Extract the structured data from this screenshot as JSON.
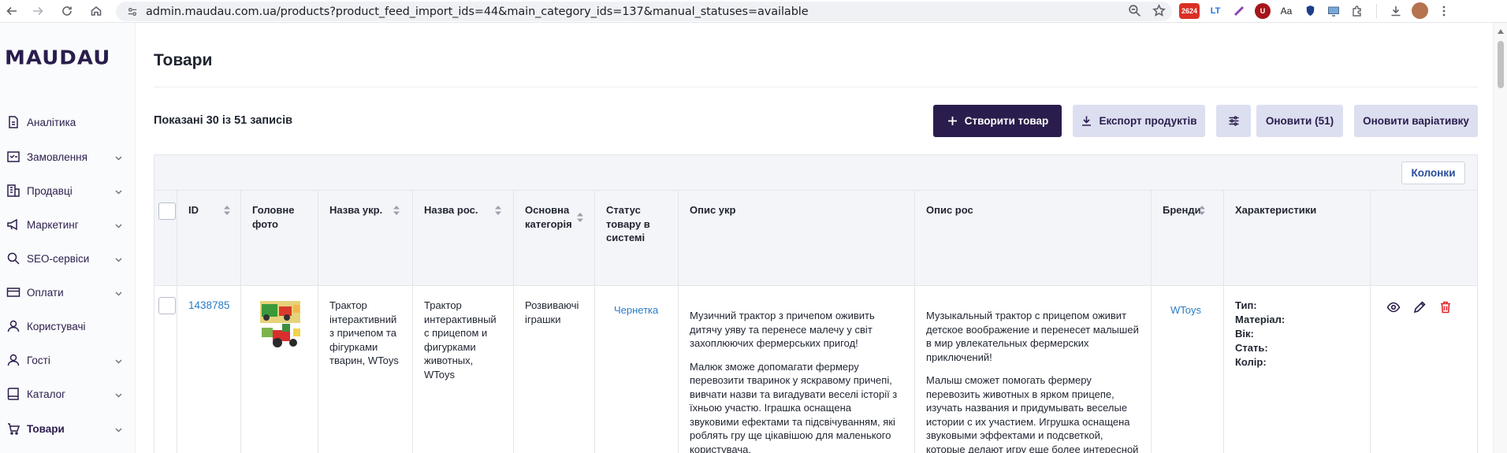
{
  "browser": {
    "url": "admin.maudau.com.ua/products?product_feed_import_ids=44&main_category_ids=137&manual_statuses=available",
    "ext_badge": "2624",
    "ext_lt": "LT",
    "ext_u": "U",
    "ext_aa": "Aa"
  },
  "sidebar": {
    "logo": "MAUDAU",
    "items": [
      {
        "label": "Аналітика",
        "icon": "analytics-icon"
      },
      {
        "label": "Замовлення",
        "icon": "orders-icon"
      },
      {
        "label": "Продавці",
        "icon": "sellers-icon"
      },
      {
        "label": "Маркетинг",
        "icon": "marketing-icon"
      },
      {
        "label": "SEO-сервіси",
        "icon": "seo-icon"
      },
      {
        "label": "Оплати",
        "icon": "payments-icon"
      },
      {
        "label": "Користувачі",
        "icon": "users-icon"
      },
      {
        "label": "Гості",
        "icon": "guests-icon"
      },
      {
        "label": "Каталог",
        "icon": "catalog-icon"
      },
      {
        "label": "Товари",
        "icon": "products-icon"
      }
    ]
  },
  "page": {
    "title": "Товари",
    "records": "Показані 30 із 51 записів"
  },
  "actions": {
    "create": "Створити товар",
    "export": "Експорт продуктів",
    "update": "Оновити (51)",
    "update_variant": "Оновити варіативку",
    "columns": "Колонки"
  },
  "table": {
    "headers": {
      "id": "ID",
      "photo": "Головне фото",
      "name_ukr": "Назва укр.",
      "name_rus": "Назва рос.",
      "category": "Основна категорія",
      "status": "Статус товару в системі",
      "desc_ukr": "Опис укр",
      "desc_rus": "Опис рос",
      "brands": "Бренди",
      "characteristics": "Характеристики"
    },
    "row": {
      "id": "1438785",
      "name_ukr": "Трактор інтерактивний з причепом та фігурками тварин, WToys",
      "name_rus": "Трактор интерактивный с прицепом и фигурками животных, WToys",
      "category": "Розвиваючі іграшки",
      "status": "Чернетка",
      "desc_ukr_p1": "Музичний трактор з причепом оживить дитячу уяву та перенесе малечу у світ захоплюючих фермерських пригод!",
      "desc_ukr_p2": "Малюк зможе допомагати фермеру перевозити тваринок у яскравому причепі, вивчати назви та вигадувати веселі історії з їхньою участю. Іграшка оснащена звуковими ефектами та підсвічуванням, які роблять гру ще цікавішою для маленького користувача.",
      "desc_rus_p1": "Музыкальный трактор с прицепом оживит детское воображение и перенесет малышей в мир увлекательных фермерских приключений!",
      "desc_rus_p2": "Малыш сможет помогать фермеру перевозить животных в ярком прицепе, изучать названия и придумывать веселые истории с их участием. Игрушка оснащена звуковыми эффектами и подсветкой, которые делают игру еще более интересной",
      "brand": "WToys",
      "char_type": "Тип:",
      "char_material": "Матеріал:",
      "char_age": "Вік:",
      "char_gender": "Стать:",
      "char_color": "Колір:"
    }
  }
}
